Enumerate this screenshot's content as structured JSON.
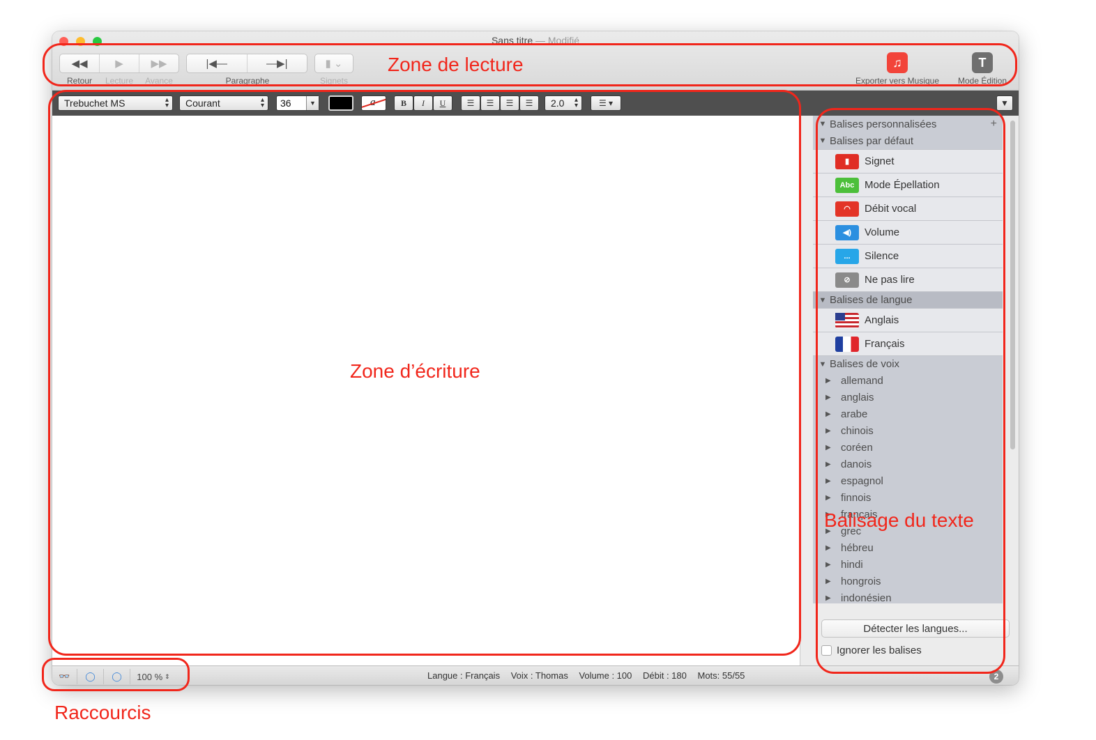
{
  "window": {
    "title": "Sans titre",
    "title_separator": "—",
    "title_modified": "Modifié"
  },
  "toolbar": {
    "retour_label": "Retour",
    "lecture_label": "Lecture",
    "avance_label": "Avance",
    "paragraphe_label": "Paragraphe",
    "signets_label": "Signets",
    "exporter_label": "Exporter vers Musique",
    "mode_edition_label": "Mode Édition",
    "mode_edition_icon_letter": "T"
  },
  "format": {
    "font": "Trebuchet MS",
    "style": "Courant",
    "size": "36",
    "highlight_glyph": "a",
    "bold": "B",
    "italic": "I",
    "underline": "U",
    "line_spacing": "2.0"
  },
  "sidebar": {
    "sections": {
      "personnalisees": "Balises personnalisées",
      "par_defaut": "Balises par défaut",
      "langue": "Balises de langue",
      "voix": "Balises de voix"
    },
    "default_tags": [
      {
        "label": "Signet",
        "icon": "bookmark-icon",
        "color": "#e02d24"
      },
      {
        "label": "Mode Épellation",
        "icon": "abc-icon",
        "color": "#4cbf3a"
      },
      {
        "label": "Débit vocal",
        "icon": "speed-gauge-icon",
        "color": "#e33427"
      },
      {
        "label": "Volume",
        "icon": "speaker-icon",
        "color": "#2b8fe0"
      },
      {
        "label": "Silence",
        "icon": "ellipsis-icon",
        "color": "#27a6e8"
      },
      {
        "label": "Ne pas lire",
        "icon": "hidden-eye-icon",
        "color": "#8a8a8a"
      }
    ],
    "language_tags": [
      {
        "label": "Anglais",
        "icon": "us-flag-icon"
      },
      {
        "label": "Français",
        "icon": "fr-flag-icon"
      }
    ],
    "voices": [
      "allemand",
      "anglais",
      "arabe",
      "chinois",
      "coréen",
      "danois",
      "espagnol",
      "finnois",
      "français",
      "grec",
      "hébreu",
      "hindi",
      "hongrois",
      "indonésien"
    ],
    "detect_button": "Détecter les langues...",
    "ignore_label": "Ignorer les balises"
  },
  "status": {
    "zoom": "100 %",
    "langue": "Langue : Français",
    "voix": "Voix : Thomas",
    "volume": "Volume : 100",
    "debit": "Débit : 180",
    "mots": "Mots: 55/55",
    "notification_count": "2"
  },
  "annotations": {
    "lecture": "Zone de lecture",
    "ecriture": "Zone d’écriture",
    "balisage": "Balisage du texte",
    "raccourcis": "Raccourcis"
  },
  "colors": {
    "annotation_red": "#f1261b",
    "music_icon": "#f2443a",
    "traffic_red": "#ff5f57",
    "traffic_yellow": "#febc2e",
    "traffic_green": "#28c840"
  }
}
